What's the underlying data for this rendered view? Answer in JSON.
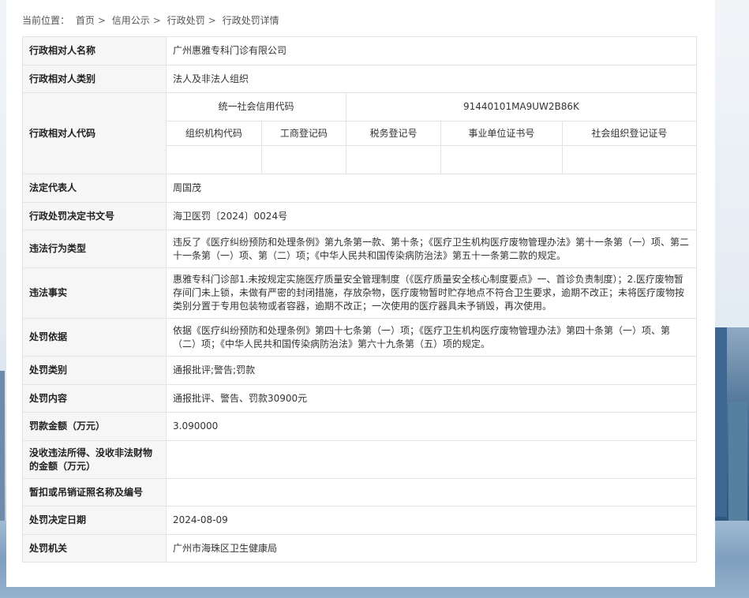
{
  "breadcrumb": {
    "prefix": "当前位置：",
    "items": [
      "首页",
      "信用公示",
      "行政处罚",
      "行政处罚详情"
    ],
    "separator": ">"
  },
  "record": {
    "party_name": {
      "label": "行政相对人名称",
      "value": "广州惠雅专科门诊有限公司"
    },
    "party_type": {
      "label": "行政相对人类别",
      "value": "法人及非法人组织"
    },
    "party_code": {
      "label": "行政相对人代码",
      "credit_code_label": "统一社会信用代码",
      "credit_code_value": "91440101MA9UW2B86K",
      "sub_headers": [
        "组织机构代码",
        "工商登记码",
        "税务登记号",
        "事业单位证书号",
        "社会组织登记证号"
      ],
      "sub_values": [
        "",
        "",
        "",
        "",
        ""
      ]
    },
    "legal_rep": {
      "label": "法定代表人",
      "value": "周国茂"
    },
    "decision_no": {
      "label": "行政处罚决定书文号",
      "value": "海卫医罚〔2024〕0024号"
    },
    "violation_type": {
      "label": "违法行为类型",
      "value": "违反了《医疗纠纷预防和处理条例》第九条第一款、第十条；《医疗卫生机构医疗废物管理办法》第十一条第（一）项、第二十一条第（一）项、第（二）项；《中华人民共和国传染病防治法》第五十一条第二款的规定。"
    },
    "facts": {
      "label": "违法事实",
      "value": "惠雅专科门诊部1.未按规定实施医疗质量安全管理制度（《医疗质量安全核心制度要点》一、首诊负责制度）；2.医疗废物暂存间门未上锁，未做有严密的封闭措施，存放杂物，医疗废物暂时贮存地点不符合卫生要求，逾期不改正；未将医疗废物按类别分置于专用包装物或者容器，逾期不改正；一次使用的医疗器具未予销毁，再次使用。"
    },
    "basis": {
      "label": "处罚依据",
      "value": "依据《医疗纠纷预防和处理条例》第四十七条第（一）项；《医疗卫生机构医疗废物管理办法》第四十条第（一）项、第（二）项；《中华人民共和国传染病防治法》第六十九条第（五）项的规定。"
    },
    "penalty_type": {
      "label": "处罚类别",
      "value": "通报批评;警告;罚款"
    },
    "penalty_content": {
      "label": "处罚内容",
      "value": "通报批评、警告、罚款30900元"
    },
    "fine_amount": {
      "label": "罚款金额（万元）",
      "value": "3.090000"
    },
    "confiscated": {
      "label": "没收违法所得、没收非法财物的金额（万元）",
      "value": ""
    },
    "license": {
      "label": "暂扣或吊销证照名称及编号",
      "value": ""
    },
    "decision_date": {
      "label": "处罚决定日期",
      "value": "2024-08-09"
    },
    "authority": {
      "label": "处罚机关",
      "value": "广州市海珠区卫生健康局"
    }
  }
}
